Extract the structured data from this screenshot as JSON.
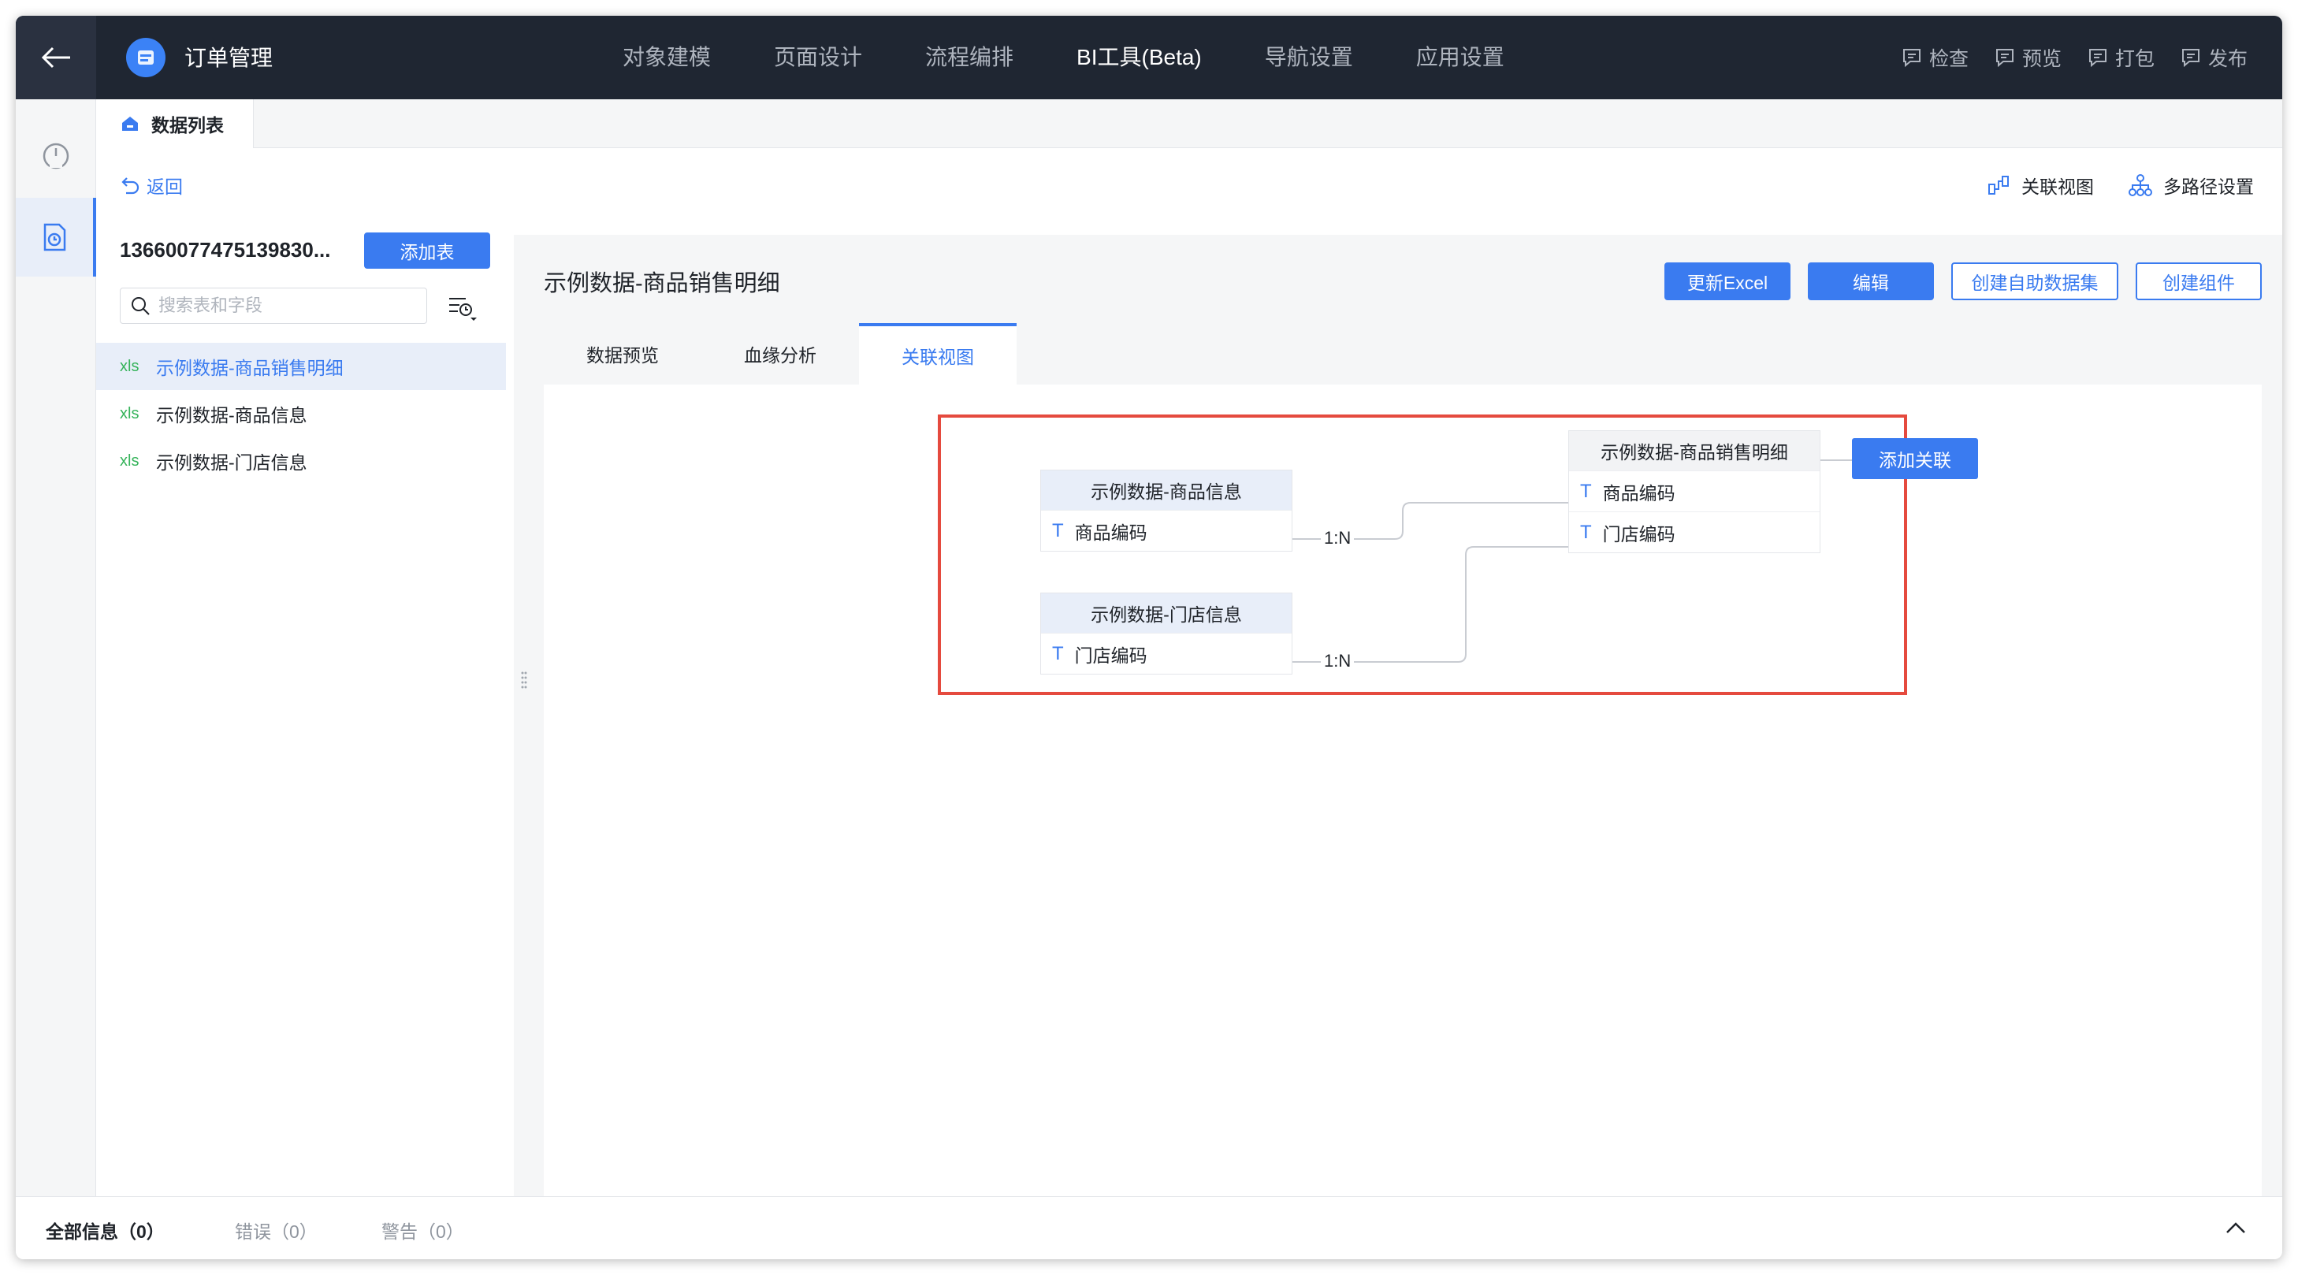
{
  "app": {
    "name": "订单管理",
    "nav": [
      "对象建模",
      "页面设计",
      "流程编排",
      "BI工具(Beta)",
      "导航设置",
      "应用设置"
    ],
    "active_nav": "BI工具(Beta)",
    "actions": [
      "检查",
      "预览",
      "打包",
      "发布"
    ]
  },
  "page_tab": {
    "label": "数据列表"
  },
  "subheader": {
    "back_label": "返回",
    "right_links": [
      "关联视图",
      "多路径设置"
    ]
  },
  "left_panel": {
    "project_name": "13660077475139830...",
    "add_table_label": "添加表",
    "search_placeholder": "搜索表和字段",
    "file_tag": "xls",
    "tables": [
      "示例数据-商品销售明细",
      "示例数据-商品信息",
      "示例数据-门店信息"
    ],
    "selected_index": 0
  },
  "main": {
    "title": "示例数据-商品销售明细",
    "buttons": [
      "更新Excel",
      "编辑",
      "创建自助数据集",
      "创建组件"
    ],
    "tabs": [
      "数据预览",
      "血缘分析",
      "关联视图"
    ],
    "active_tab": "关联视图"
  },
  "diagram": {
    "entities": [
      {
        "title": "示例数据-商品信息",
        "fields": [
          "商品编码"
        ]
      },
      {
        "title": "示例数据-门店信息",
        "fields": [
          "门店编码"
        ]
      },
      {
        "title": "示例数据-商品销售明细",
        "fields": [
          "商品编码",
          "门店编码"
        ]
      }
    ],
    "relations": [
      "1:N",
      "1:N"
    ],
    "add_relation_label": "添加关联"
  },
  "bottom": {
    "tabs": [
      "全部信息（0）",
      "错误（0）",
      "警告（0）"
    ]
  },
  "colors": {
    "accent": "#3a7bf0",
    "topbar": "#1f2632",
    "highlight": "#e54a3e"
  }
}
